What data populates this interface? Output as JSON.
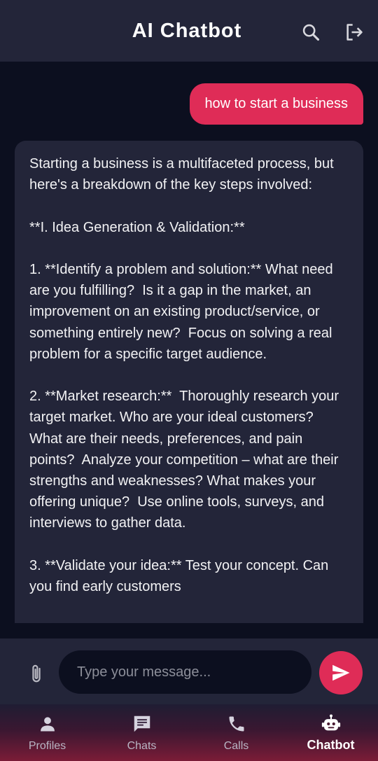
{
  "header": {
    "title": "AI Chatbot",
    "search_icon": "search-icon",
    "logout_icon": "logout-icon"
  },
  "chat": {
    "user_message": "how to start a business",
    "bot_message": "Starting a business is a multifaceted process, but here's a breakdown of the key steps involved:\n\n**I. Idea Generation & Validation:**\n\n1. **Identify a problem and solution:** What need are you fulfilling?  Is it a gap in the market, an improvement on an existing product/service, or something entirely new?  Focus on solving a real problem for a specific target audience.\n\n2. **Market research:**  Thoroughly research your target market. Who are your ideal customers? What are their needs, preferences, and pain points?  Analyze your competition – what are their strengths and weaknesses? What makes your offering unique?  Use online tools, surveys, and interviews to gather data.\n\n3. **Validate your idea:** Test your concept. Can you find early customers"
  },
  "input": {
    "placeholder": "Type your message...",
    "value": "",
    "attach_icon": "paperclip-icon",
    "send_icon": "send-icon"
  },
  "nav": {
    "items": [
      {
        "label": "Profiles",
        "icon": "person-icon",
        "active": false
      },
      {
        "label": "Chats",
        "icon": "chat-icon",
        "active": false
      },
      {
        "label": "Calls",
        "icon": "phone-icon",
        "active": false
      },
      {
        "label": "Chatbot",
        "icon": "robot-icon",
        "active": true
      }
    ]
  },
  "colors": {
    "background": "#0c0f1f",
    "surface": "#232539",
    "accent": "#df2c57",
    "text": "#ffffff",
    "muted": "#b9b6c4"
  }
}
